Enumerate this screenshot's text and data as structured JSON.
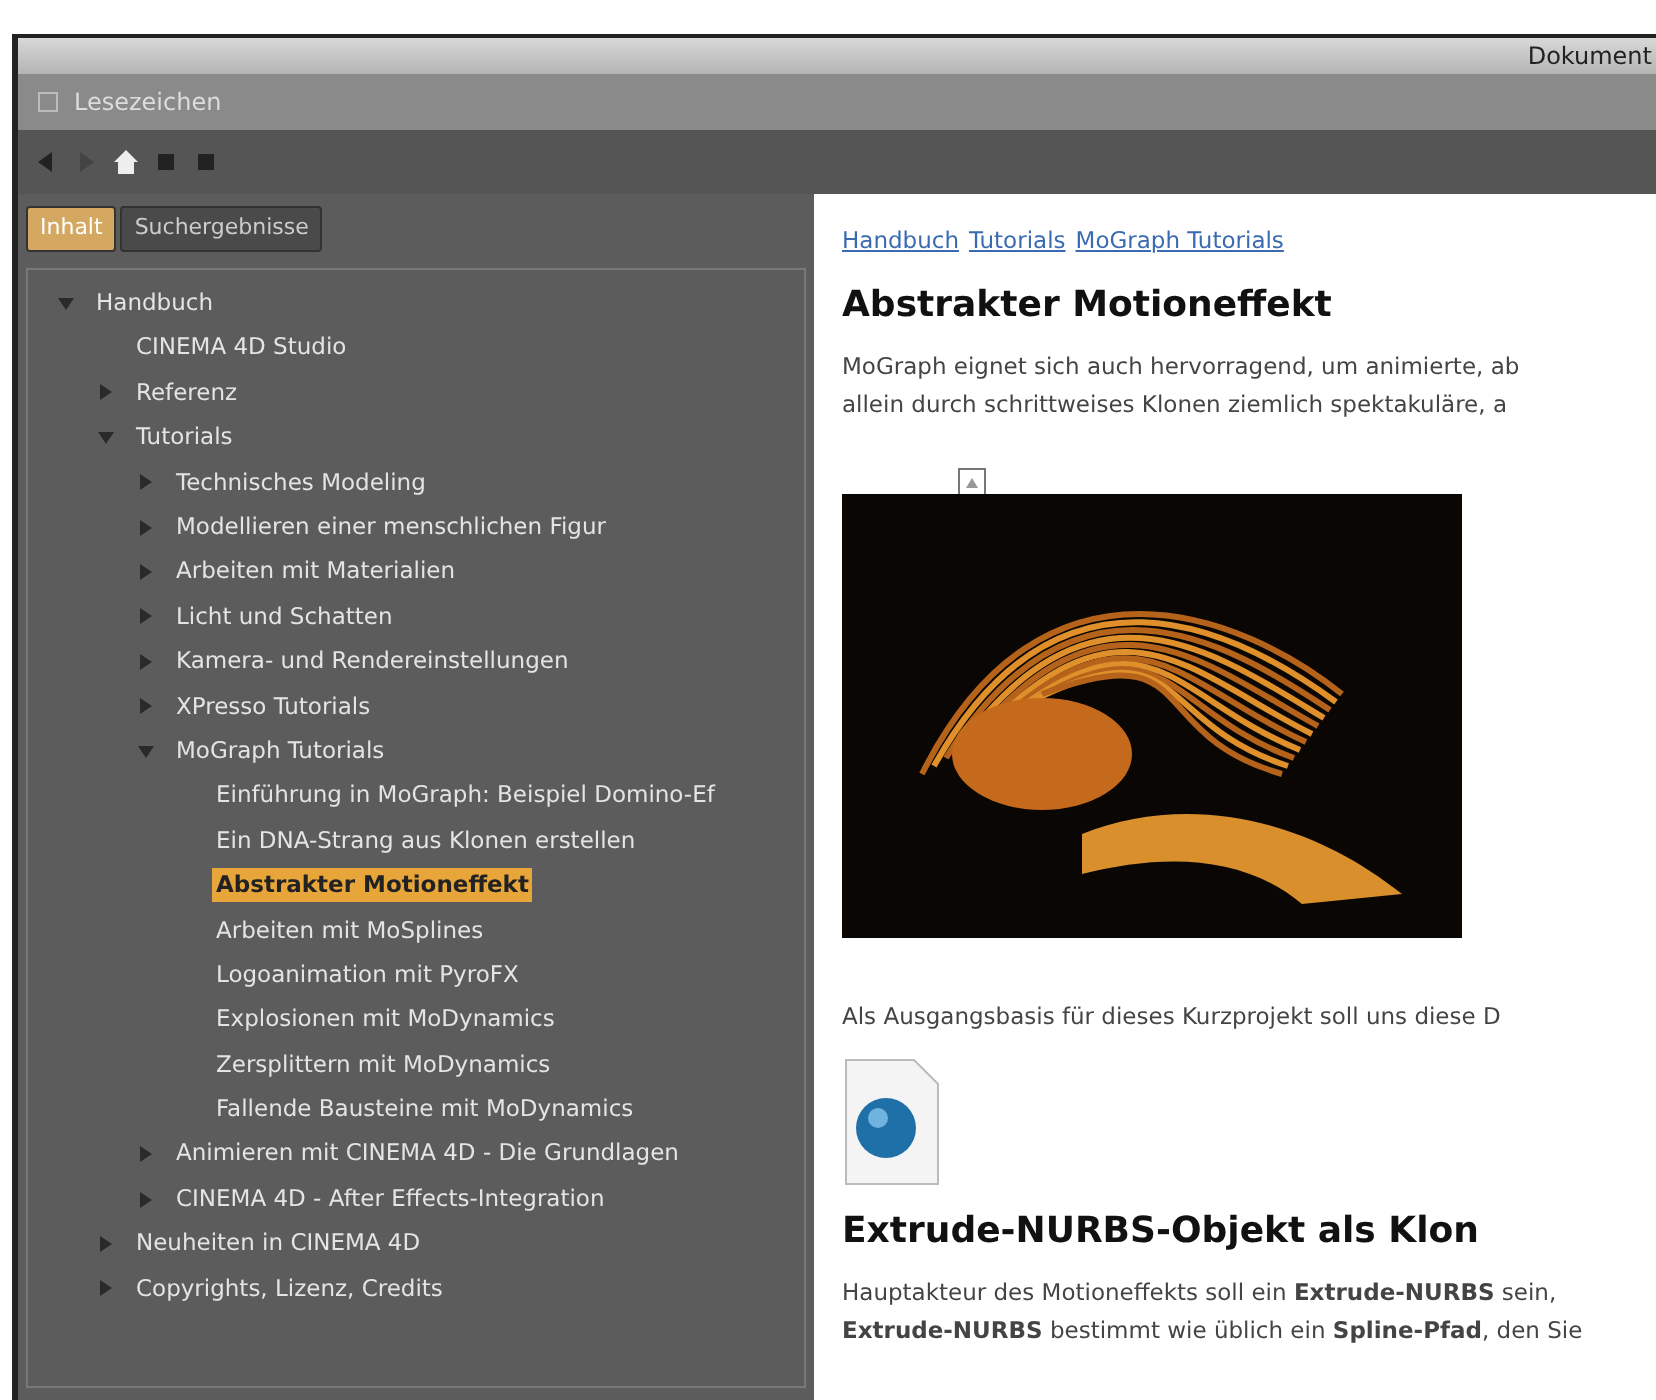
{
  "window": {
    "title": "Dokument"
  },
  "panel": {
    "title": "Lesezeichen"
  },
  "toolbar": [
    {
      "kind": "back"
    },
    {
      "kind": "forward"
    },
    {
      "kind": "home"
    },
    {
      "kind": "square"
    },
    {
      "kind": "square"
    }
  ],
  "tabs": [
    {
      "label": "Inhalt",
      "selected": true
    },
    {
      "label": "Suchergebnisse",
      "selected": false
    }
  ],
  "tree": [
    {
      "label": "Handbuch",
      "expanded": true,
      "selected": false,
      "children": [
        {
          "label": "CINEMA 4D Studio",
          "selected": false
        },
        {
          "label": "Referenz",
          "expanded": false,
          "selected": false
        },
        {
          "label": "Tutorials",
          "expanded": true,
          "selected": false,
          "children": [
            {
              "label": "Technisches Modeling",
              "expanded": false,
              "selected": false
            },
            {
              "label": "Modellieren einer menschlichen Figur",
              "expanded": false,
              "selected": false
            },
            {
              "label": "Arbeiten mit Materialien",
              "expanded": false,
              "selected": false
            },
            {
              "label": "Licht und Schatten",
              "expanded": false,
              "selected": false
            },
            {
              "label": "Kamera- und Rendereinstellungen",
              "expanded": false,
              "selected": false
            },
            {
              "label": "XPresso Tutorials",
              "expanded": false,
              "selected": false
            },
            {
              "label": "MoGraph Tutorials",
              "expanded": true,
              "selected": false,
              "children": [
                {
                  "label": "Einführung in MoGraph: Beispiel Domino-Ef",
                  "selected": false
                },
                {
                  "label": "Ein DNA-Strang aus Klonen erstellen",
                  "selected": false
                },
                {
                  "label": "Abstrakter Motioneffekt",
                  "selected": true
                },
                {
                  "label": "Arbeiten mit MoSplines",
                  "selected": false
                },
                {
                  "label": "Logoanimation mit PyroFX",
                  "selected": false
                },
                {
                  "label": "Explosionen mit MoDynamics",
                  "selected": false
                },
                {
                  "label": "Zersplittern mit MoDynamics",
                  "selected": false
                },
                {
                  "label": "Fallende Bausteine mit MoDynamics",
                  "selected": false
                }
              ]
            },
            {
              "label": "Animieren mit CINEMA 4D - Die Grundlagen",
              "expanded": false,
              "selected": false
            },
            {
              "label": "CINEMA 4D - After Effects-Integration",
              "expanded": false,
              "selected": false
            }
          ]
        },
        {
          "label": "Neuheiten in CINEMA 4D",
          "expanded": false,
          "selected": false
        },
        {
          "label": "Copyrights, Lizenz, Credits",
          "expanded": false,
          "selected": false
        }
      ]
    }
  ],
  "content": {
    "breadcrumb": [
      "Handbuch",
      "Tutorials",
      "MoGraph Tutorials"
    ],
    "blocks": [
      {
        "kind": "heading",
        "text": "Abstrakter Motioneffekt"
      },
      {
        "kind": "lines",
        "lines": [
          "MoGraph eignet sich auch hervorragend, um animierte, ab",
          "allein durch schrittweises Klonen ziemlich spektakuläre, a"
        ]
      },
      {
        "kind": "picture"
      },
      {
        "kind": "lines",
        "lines": [
          "Als Ausgangsbasis für dieses Kurzprojekt soll uns diese D"
        ]
      },
      {
        "kind": "file"
      },
      {
        "kind": "heading",
        "text": "Extrude-NURBS-Objekt als Klon"
      },
      {
        "kind": "lines",
        "lines": [
          "Hauptakteur des Motioneffekts soll ein **Extrude-NURBS** sein,",
          "**Extrude-NURBS** bestimmt wie üblich ein **Spline-Pfad**, den Sie"
        ]
      }
    ]
  }
}
